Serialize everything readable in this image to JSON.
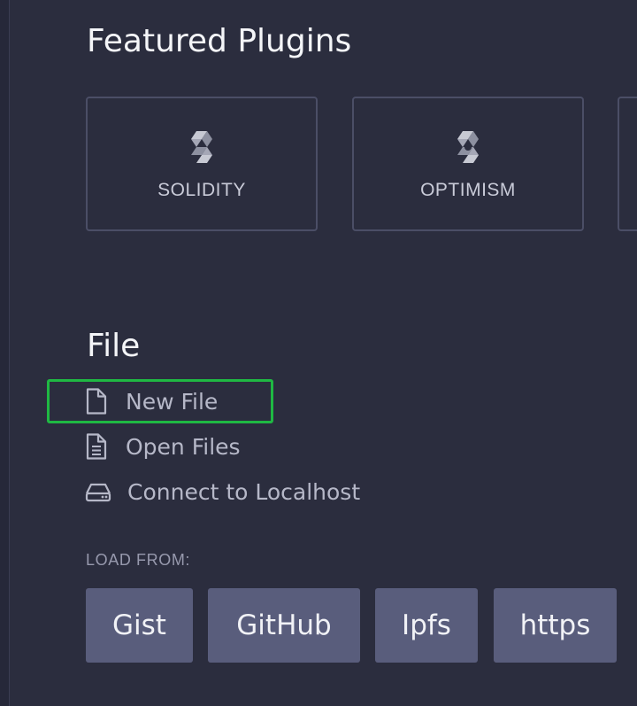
{
  "featured": {
    "title": "Featured Plugins",
    "plugins": [
      {
        "label": "SOLIDITY",
        "icon": "solidity-logo-icon"
      },
      {
        "label": "OPTIMISM",
        "icon": "optimism-logo-icon"
      }
    ]
  },
  "file": {
    "title": "File",
    "actions": [
      {
        "label": "New File",
        "icon": "new-file-icon"
      },
      {
        "label": "Open Files",
        "icon": "open-files-icon"
      },
      {
        "label": "Connect to Localhost",
        "icon": "hard-drive-icon"
      }
    ]
  },
  "load": {
    "label": "LOAD FROM:",
    "buttons": [
      "Gist",
      "GitHub",
      "Ipfs",
      "https"
    ]
  },
  "colors": {
    "background": "#2b2d3e",
    "card_border": "#4b4e66",
    "button_bg": "#595d7c",
    "highlight": "#1fb843"
  }
}
